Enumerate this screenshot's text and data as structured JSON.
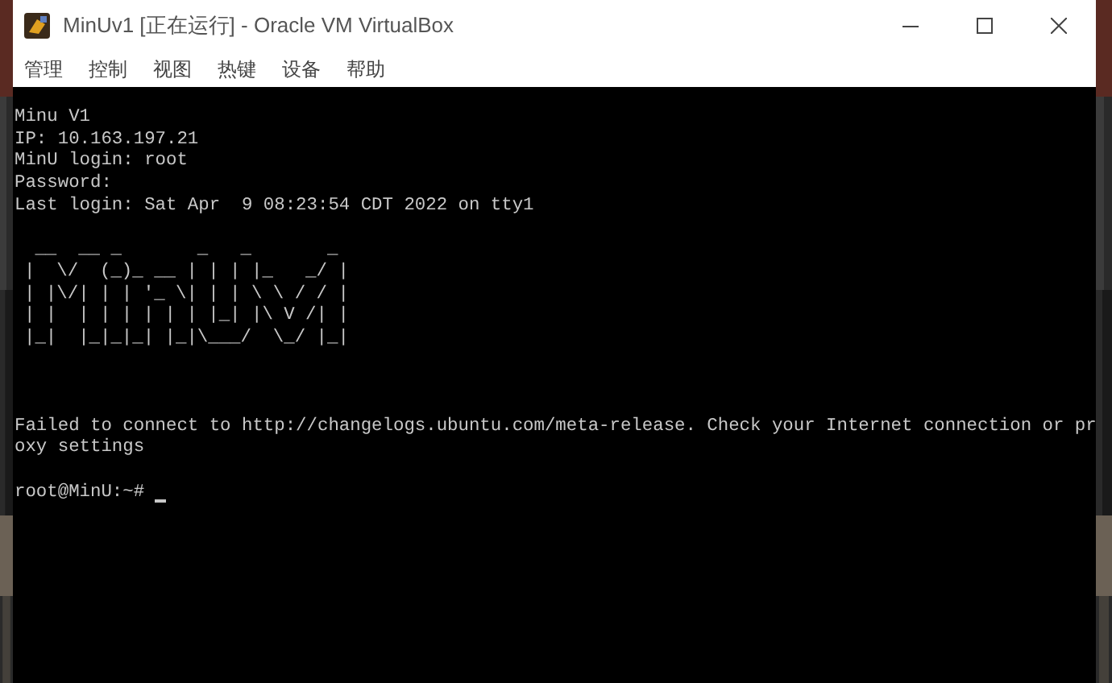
{
  "window": {
    "title": "MinUv1 [正在运行] - Oracle VM VirtualBox"
  },
  "menu": [
    "管理",
    "控制",
    "视图",
    "热键",
    "设备",
    "帮助"
  ],
  "terminal": {
    "login_lines": [
      "Minu V1",
      "IP: 10.163.197.21",
      "MinU login: root",
      "Password:",
      "Last login: Sat Apr  9 08:23:54 CDT 2022 on tty1"
    ],
    "banner": [
      " __  __ _       _   _       _ ",
      "|  \\/  (_)_ __ | | | |_   _/ |",
      "| |\\/| | | '_ \\| | | \\ \\ / / |",
      "| |  | | | | | | |_| |\\ V /| |",
      "|_|  |_|_|_| |_|\\___/  \\_/ |_|"
    ],
    "message_lines": [
      "Failed to connect to http://changelogs.ubuntu.com/meta-release. Check your Internet connection or pr",
      "oxy settings"
    ],
    "prompt": "root@MinU:~# "
  }
}
